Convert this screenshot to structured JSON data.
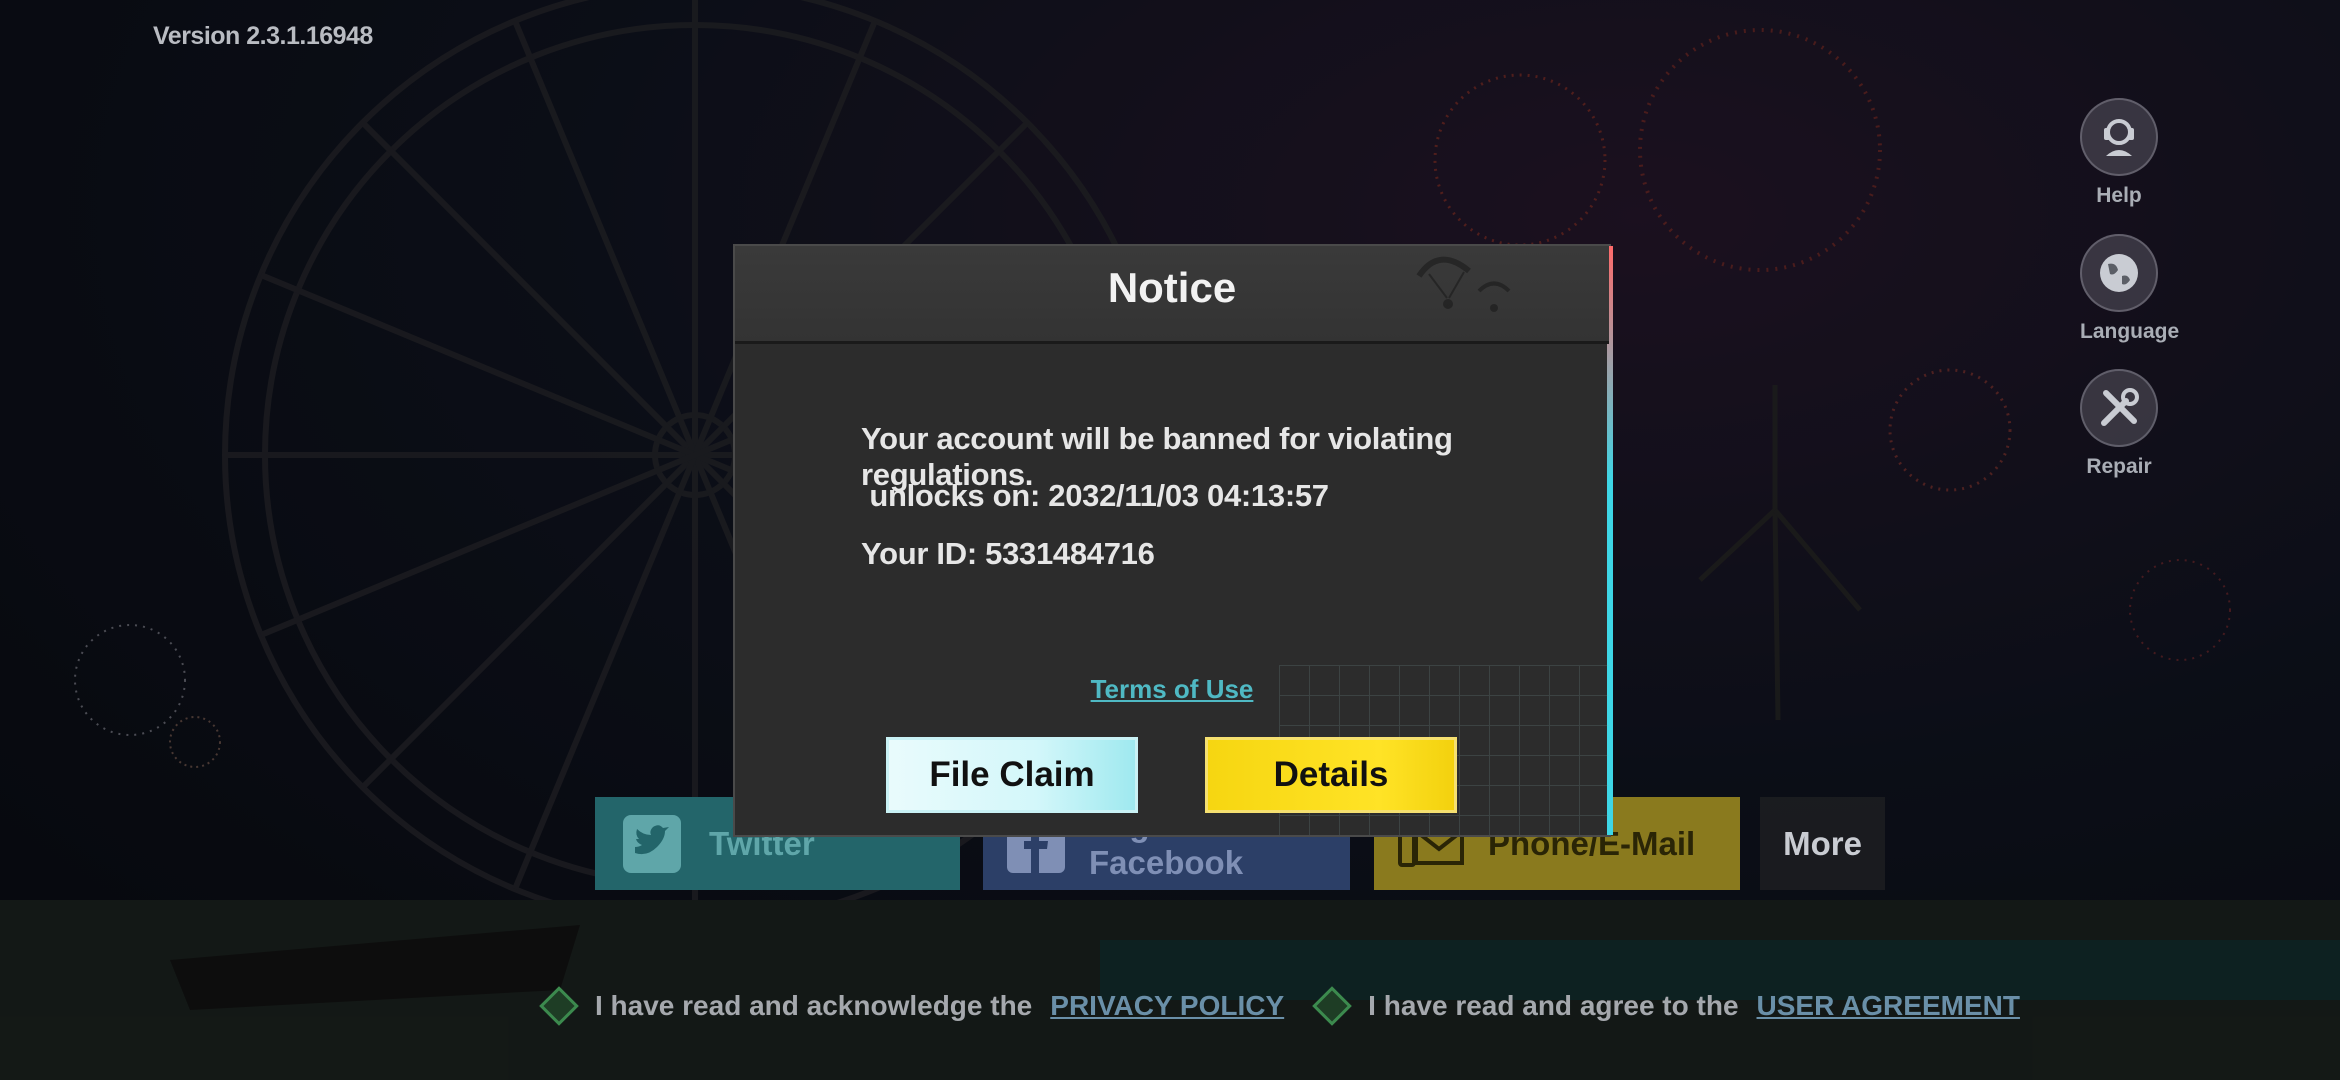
{
  "version": "Version 2.3.1.16948",
  "side_menu": {
    "help": "Help",
    "language": "Language",
    "repair": "Repair"
  },
  "login": {
    "twitter": "Twitter",
    "facebook": "Login with Facebook",
    "phone": "Phone/E-Mail",
    "more": "More"
  },
  "agreements": {
    "privacy_prefix": "I have read and acknowledge the",
    "privacy_link": "PRIVACY POLICY",
    "user_prefix": "I have read and agree to the",
    "user_link": "USER AGREEMENT"
  },
  "notice": {
    "title": "Notice",
    "line1": "Your account will be banned for violating regulations.",
    "line2": " unlocks on: 2032/11/03 04:13:57",
    "line3": "Your ID: 5331484716",
    "terms": "Terms of Use",
    "file_claim": "File Claim",
    "details": "Details"
  },
  "colors": {
    "claim_button": "#d3f7fa",
    "details_button": "#ffe326",
    "terms_link": "#4fb9c4",
    "twitter": "#23656a",
    "facebook": "#2c3f67",
    "phone": "#8a7a1e"
  }
}
